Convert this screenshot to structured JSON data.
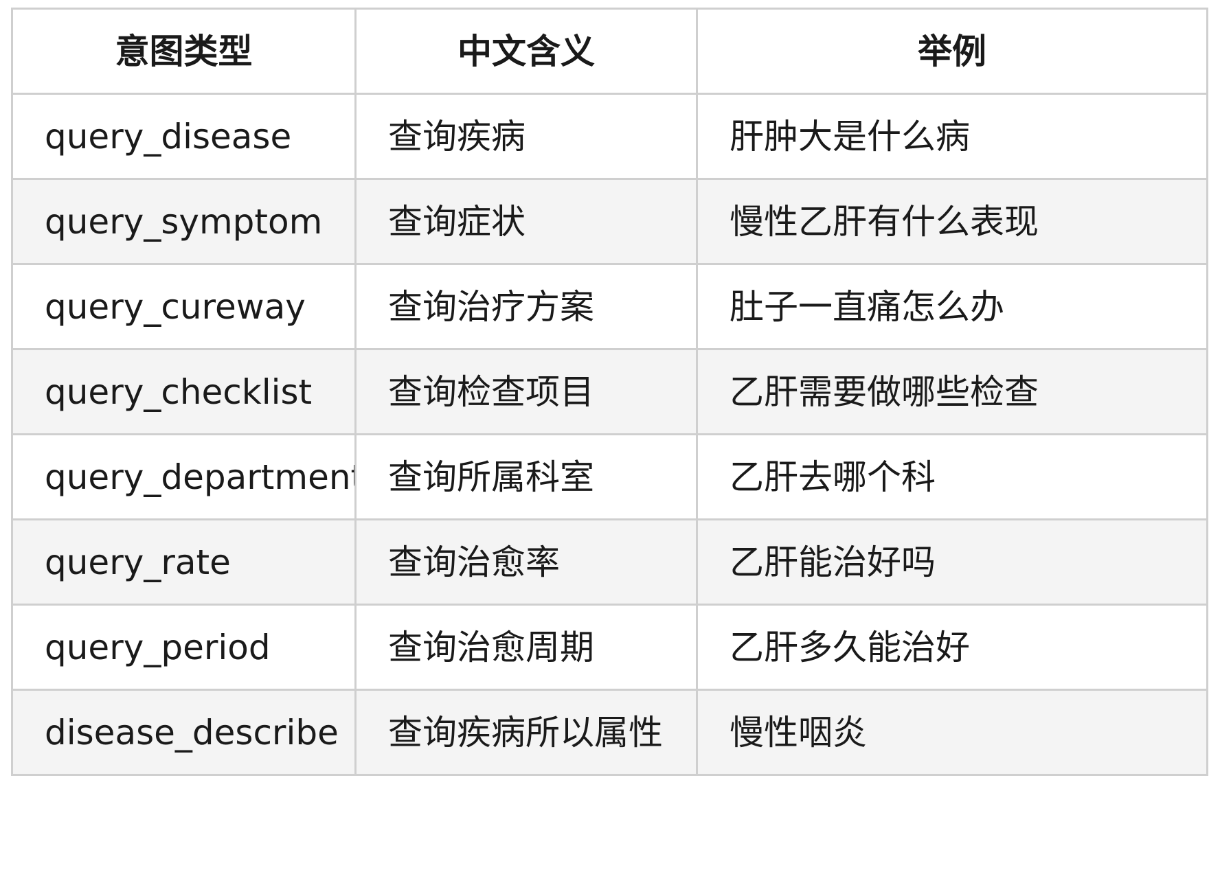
{
  "table": {
    "headers": [
      "意图类型",
      "中文含义",
      "举例"
    ],
    "rows": [
      [
        "query_disease",
        "查询疾病",
        "肝肿大是什么病"
      ],
      [
        "query_symptom",
        "查询症状",
        "慢性乙肝有什么表现"
      ],
      [
        "query_cureway",
        "查询治疗方案",
        "肚子一直痛怎么办"
      ],
      [
        "query_checklist",
        "查询检查项目",
        "乙肝需要做哪些检查"
      ],
      [
        "query_department",
        "查询所属科室",
        "乙肝去哪个科"
      ],
      [
        "query_rate",
        "查询治愈率",
        "乙肝能治好吗"
      ],
      [
        "query_period",
        "查询治愈周期",
        "乙肝多久能治好"
      ],
      [
        "disease_describe",
        "查询疾病所以属性",
        "慢性咽炎"
      ]
    ]
  },
  "colors": {
    "border": "#cfcfcf",
    "row_alt_background": "#f4f4f4",
    "text": "#1a1a1a"
  }
}
